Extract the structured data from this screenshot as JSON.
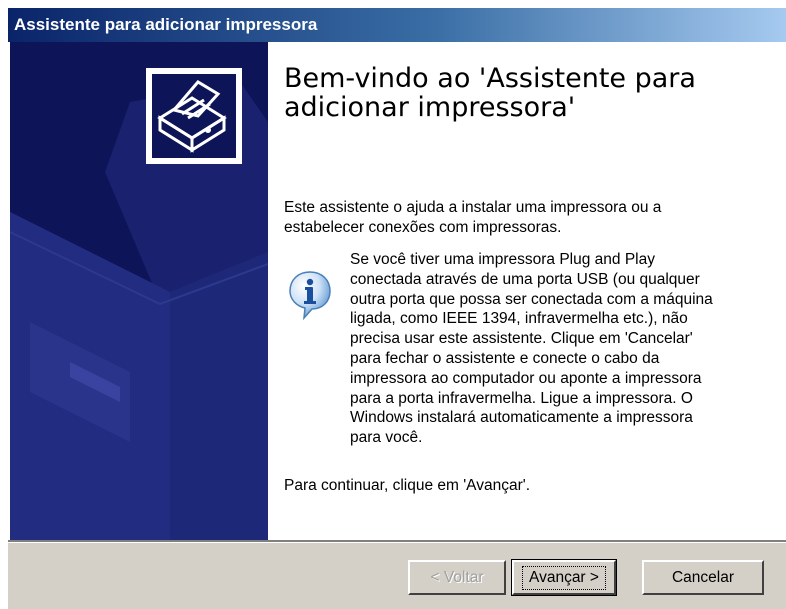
{
  "window": {
    "title": "Assistente para adicionar impressora"
  },
  "banner": {
    "icon": "printer-wizard-icon"
  },
  "content": {
    "heading": "Bem-vindo ao 'Assistente para\nadicionar impressora'",
    "intro": "Este assistente o ajuda a instalar uma impressora ou a\nestabelecer conexões com impressoras.",
    "info_icon": "info-icon",
    "info_text": "Se você tiver uma impressora Plug and Play\nconectada através de uma porta USB (ou qualquer\noutra porta que possa ser conectada com a máquina\nligada, como IEEE 1394, infravermelha etc.), não\nprecisa usar este assistente. Clique em 'Cancelar'\npara fechar o assistente e conecte o cabo da\nimpressora ao computador ou aponte a impressora\npara a porta infravermelha. Ligue a impressora. O\nWindows instalará automaticamente a impressora\npara você.",
    "continue_text": "Para continuar, clique em 'Avançar'."
  },
  "buttons": {
    "back": "< Voltar",
    "next": "Avançar >",
    "cancel": "Cancelar"
  },
  "colors": {
    "banner_bg": "#0d1458",
    "titlebar_start": "#0a246a",
    "footer_bg": "#d4d0c8"
  }
}
